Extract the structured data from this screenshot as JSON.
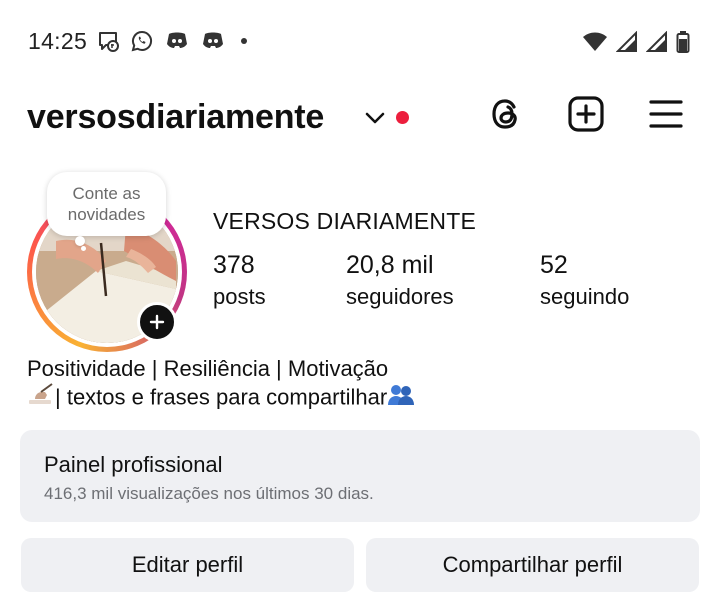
{
  "status_bar": {
    "time": "14:25",
    "left_icons": [
      "messenger-icon",
      "whatsapp-icon",
      "discord-icon",
      "discord-icon",
      "dot-icon"
    ],
    "right_icons": [
      "wifi-icon",
      "signal-icon",
      "signal-icon",
      "battery-icon"
    ]
  },
  "header": {
    "username": "versosdiariamente",
    "notification_dot_color": "#ec1e3d",
    "icons": [
      "threads-icon",
      "add-icon",
      "menu-icon"
    ]
  },
  "profile": {
    "note_text": "Conte as novidades",
    "display_name": "VERSOS DIARIAMENTE",
    "stats": [
      {
        "value": "378",
        "label": "posts"
      },
      {
        "value": "20,8 mil",
        "label": "seguidores"
      },
      {
        "value": "52",
        "label": "seguindo"
      }
    ],
    "bio_line1": "Positividade | Resiliência | Motivação",
    "bio_line2": "| textos e frases para compartilhar",
    "story_ring_colors": [
      "#f9b233",
      "#fd5949",
      "#d6249f",
      "#c13584"
    ]
  },
  "dashboard": {
    "title": "Painel profissional",
    "subtitle": "416,3 mil visualizações nos últimos 30 dias."
  },
  "actions": {
    "edit_label": "Editar perfil",
    "share_label": "Compartilhar perfil"
  }
}
